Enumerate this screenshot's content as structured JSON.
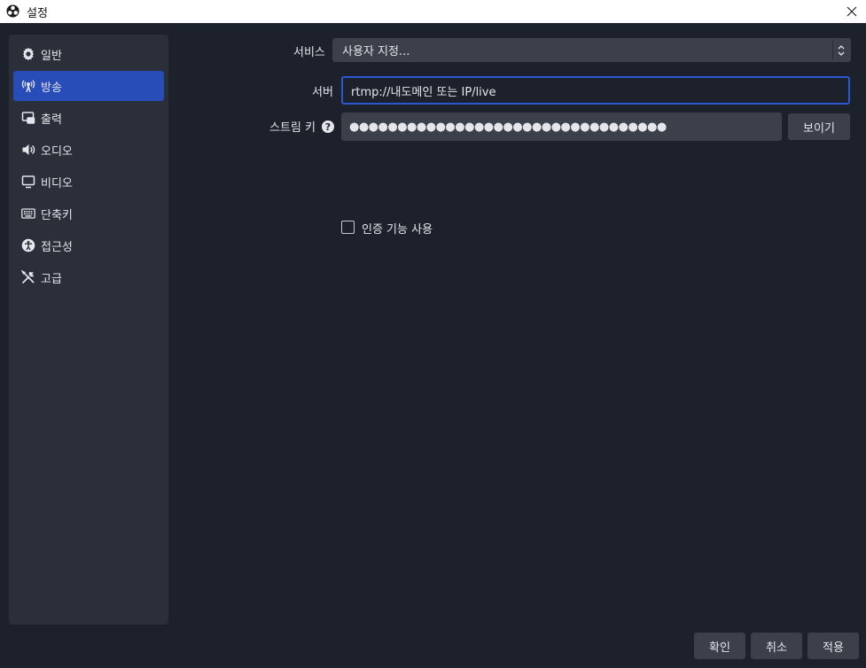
{
  "window": {
    "title": "설정"
  },
  "sidebar": {
    "items": [
      {
        "label": "일반",
        "icon": "gear-icon"
      },
      {
        "label": "방송",
        "icon": "broadcast-icon"
      },
      {
        "label": "출력",
        "icon": "output-icon"
      },
      {
        "label": "오디오",
        "icon": "speaker-icon"
      },
      {
        "label": "비디오",
        "icon": "monitor-icon"
      },
      {
        "label": "단축키",
        "icon": "keyboard-icon"
      },
      {
        "label": "접근성",
        "icon": "accessibility-icon"
      },
      {
        "label": "고급",
        "icon": "tools-icon"
      }
    ],
    "active_index": 1
  },
  "stream": {
    "service_label": "서비스",
    "service_value": "사용자 지정...",
    "server_label": "서버",
    "server_value": "rtmp://내도메인 또는 IP/live",
    "key_label": "스트림 키",
    "key_value": "●●●●●●●●●●●●●●●●●●●●●●●●●●●●●●●●●",
    "show_button": "보이기",
    "auth_label": "인증 기능 사용",
    "auth_checked": false
  },
  "footer": {
    "ok": "확인",
    "cancel": "취소",
    "apply": "적용"
  },
  "colors": {
    "background": "#1d212b",
    "sidebar": "#2a2f3a",
    "active": "#284cb8",
    "input_focus": "#2d57d3",
    "control": "#3c404b"
  }
}
